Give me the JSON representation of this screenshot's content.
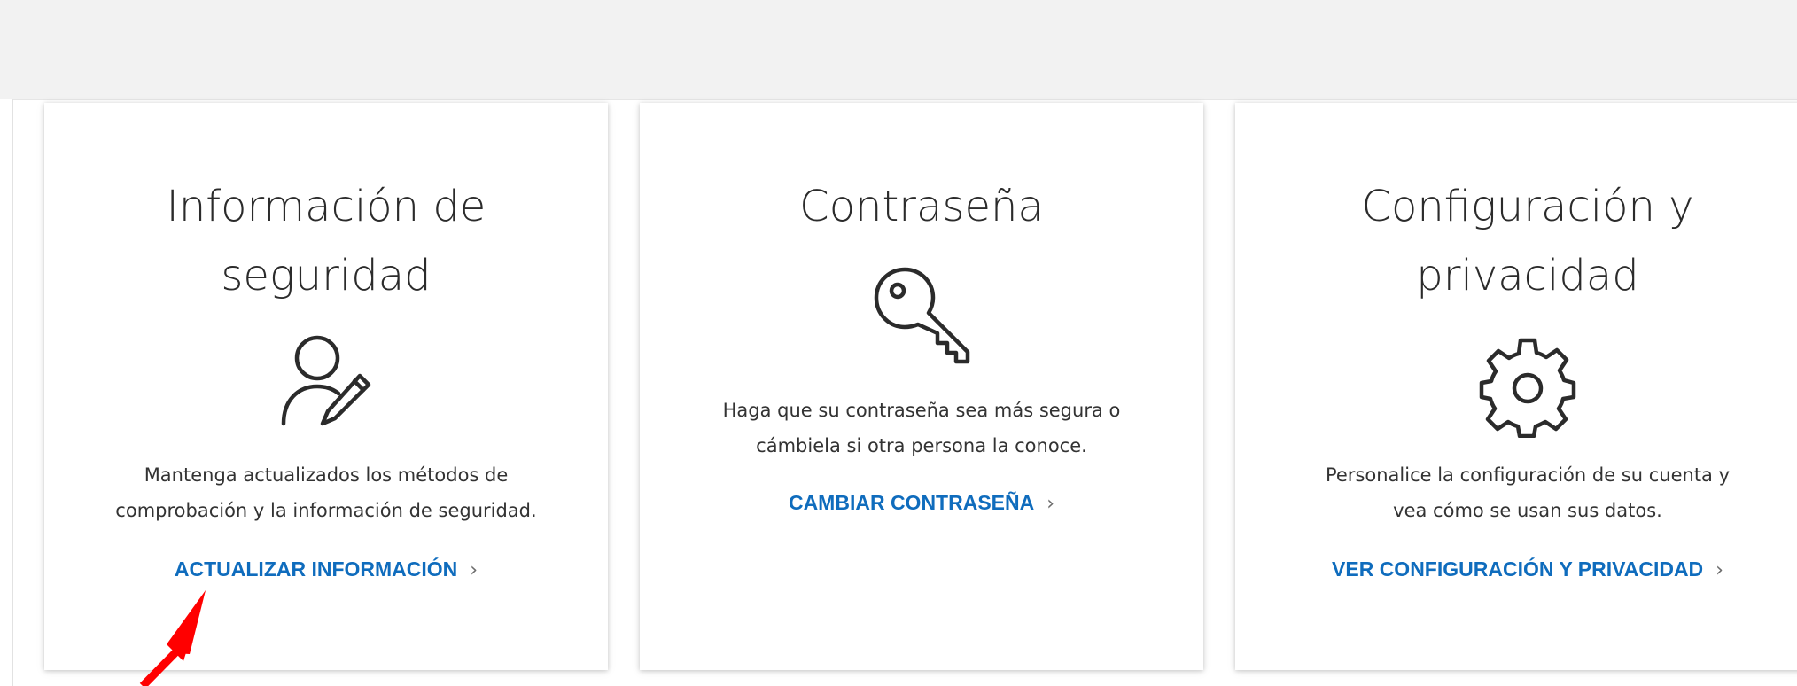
{
  "cards": [
    {
      "title_line1": "Información de",
      "title_line2": "seguridad",
      "icon": "user-edit-icon",
      "description_line1": "Mantenga actualizados los métodos de",
      "description_line2": "comprobación y la información de seguridad.",
      "link_label": "ACTUALIZAR INFORMACIÓN"
    },
    {
      "title_line1": "Contraseña",
      "icon": "key-icon",
      "description_line1": "Haga que su contraseña sea más segura o",
      "description_line2": "cámbiela si otra persona la conoce.",
      "link_label": "CAMBIAR CONTRASEÑA"
    },
    {
      "title_line1": "Configuración y",
      "title_line2": "privacidad",
      "icon": "gear-icon",
      "description_line1": "Personalice la configuración de su cuenta y",
      "description_line2": "vea cómo se usan sus datos.",
      "link_label": "VER CONFIGURACIÓN Y PRIVACIDAD"
    }
  ],
  "chevron": "›",
  "colors": {
    "link": "#0f6cbd",
    "annotation_arrow": "#ff0000",
    "top_band": "#f2f2f2"
  },
  "annotation": {
    "icon": "red-arrow-icon"
  }
}
